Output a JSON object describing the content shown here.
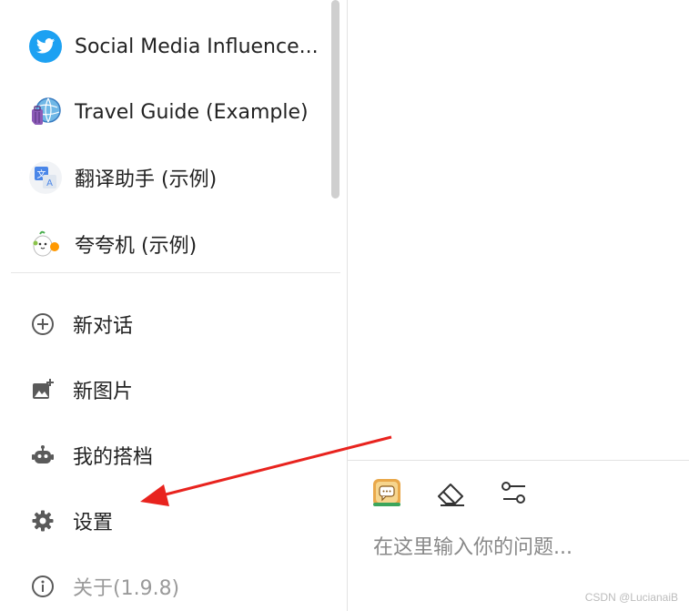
{
  "sidebar": {
    "bots": [
      {
        "label": "Social Media Influence...",
        "icon": "twitter-bird-icon"
      },
      {
        "label": "Travel Guide (Example)",
        "icon": "globe-luggage-icon"
      },
      {
        "label": "翻译助手 (示例)",
        "icon": "translate-icon"
      },
      {
        "label": "夸夸机 (示例)",
        "icon": "cute-mascot-icon"
      }
    ],
    "actions": [
      {
        "label": "新对话",
        "icon": "plus-circle-icon"
      },
      {
        "label": "新图片",
        "icon": "add-image-icon"
      },
      {
        "label": "我的搭档",
        "icon": "robot-icon"
      },
      {
        "label": "设置",
        "icon": "gear-icon"
      },
      {
        "label": "关于(1.9.8)",
        "icon": "info-icon"
      }
    ]
  },
  "composer": {
    "placeholder": "在这里输入你的问题...",
    "tools": [
      "prompt-library-icon",
      "eraser-icon",
      "settings-sliders-icon"
    ]
  },
  "watermark": "CSDN @LucianaiB",
  "colors": {
    "twitter": "#1DA1F2",
    "arrow": "#E8231E",
    "icon_gray": "#5a5a5a"
  }
}
